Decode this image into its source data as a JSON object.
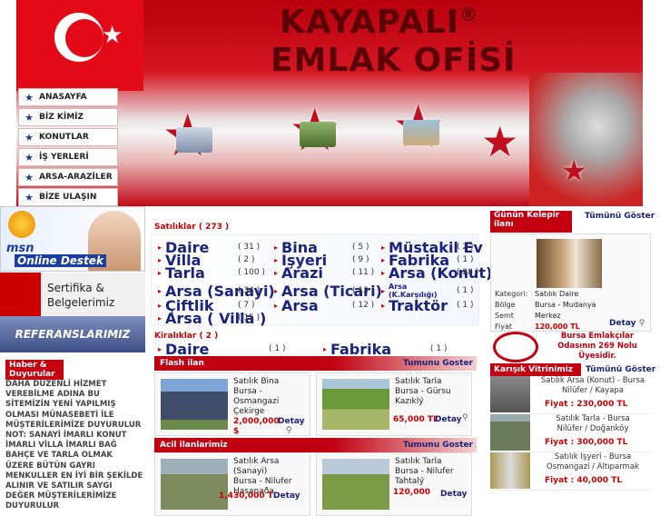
{
  "header": {
    "brand_line1": "KAYAPALI",
    "brand_mark": "®",
    "brand_line2": "EMLAK OFİSİ",
    "flag_star": "★"
  },
  "menu": [
    {
      "label": "ANASAYFA"
    },
    {
      "label": "BİZ KİMİZ"
    },
    {
      "label": "KONUTLAR"
    },
    {
      "label": "İŞ YERLERİ"
    },
    {
      "label": "ARSA-ARAZİLER"
    },
    {
      "label": "BİZE ULAŞIN"
    }
  ],
  "left": {
    "msn_line1": "msn",
    "msn_line2": "Online Destek",
    "sertifika1": "Sertifika &",
    "sertifika2": "Belgelerimiz",
    "referans": "REFERANSLARIMIZ",
    "haber_title": "Haber & Duyurular",
    "haber_text": "DAHA DÜZENLİ HİZMET VEREBİLME ADINA BU SİTEMİZİN YENİ YAPILMIŞ OLMASI MÜNASEBETİ İLE MÜŞTERİLERİMİZE DUYURULUR NOT: SANAYİ İMARLI KONUT İMARLI VİLLA İMARLI BAĞ BAHÇE VE TARLA OLMAK ÜZERE BÜTÜN GAYRI MENKULLER EN İYİ BİR ŞEKİLDE ALINIR VE SATILIR SAYGI DEĞER MÜŞTERİLERİMİZE DUYURULUR"
  },
  "satiliklar": {
    "title": "Satılıklar ( 273 )",
    "items": [
      {
        "label": "Daire",
        "count": "( 31 )"
      },
      {
        "label": "Bina",
        "count": "( 5 )"
      },
      {
        "label": "Müstakil Ev",
        "count": "( 2 )"
      },
      {
        "label": "Villa",
        "count": "( 2 )"
      },
      {
        "label": "Işyeri",
        "count": "( 9 )"
      },
      {
        "label": "Fabrika",
        "count": "( 1 )"
      },
      {
        "label": "Tarla",
        "count": "( 100 )"
      },
      {
        "label": "Arazi",
        "count": "( 11 )"
      },
      {
        "label": "Arsa (Konut)",
        "count": "( 28 )"
      },
      {
        "label": "Arsa (Sanayi)",
        "count": "( 34 )"
      },
      {
        "label": "Arsa (Ticari)",
        "count": "( 12 )"
      },
      {
        "label": "Arsa (K.Karşılığı)",
        "count": "( 1 )"
      },
      {
        "label": "Çiftlik",
        "count": "( 7 )"
      },
      {
        "label": "Arsa",
        "count": "( 12 )"
      },
      {
        "label": "Traktör",
        "count": "( 1 )"
      },
      {
        "label": "Arsa ( Villa )",
        "count": "( 15 )"
      }
    ]
  },
  "kiraliklar": {
    "title": "Kiralıklar ( 2 )",
    "items": [
      {
        "label": "Daire",
        "count": "( 1 )"
      },
      {
        "label": "Fabrika",
        "count": "( 1 )"
      }
    ]
  },
  "flash": {
    "title": "Flash ilan",
    "more": "Tumunu Goster",
    "cards": [
      {
        "l1": "Satılık Bina",
        "l2": "Bursa -",
        "l3": "Osmangazi",
        "l4": "Çekirge",
        "price": "2,000,000",
        "price2": "$",
        "detay": "Detay"
      },
      {
        "l1": "Satılık Tarla",
        "l2": "Bursa - Gürsu",
        "l3": "Kazıklý",
        "l4": "",
        "price": "65,000 TL",
        "price2": "",
        "detay": "Detay"
      }
    ]
  },
  "acil": {
    "title": "Acil ilanlarimiz",
    "more": "Tumunu Goster",
    "cards": [
      {
        "l1": "Satılık Arsa (Sanayi)",
        "l2": "Bursa - Nilufer",
        "l3": "Hasanaða",
        "price": "1,430,000 TL",
        "detay": "Detay"
      },
      {
        "l1": "Satılık Tarla",
        "l2": "Bursa - Nilufer",
        "l3": "Tahtalý",
        "price": "120,000",
        "detay": "Detay"
      }
    ]
  },
  "kelepir": {
    "title1": "Günün Kelepir",
    "title2": "ilanı",
    "more": "Tümünü Göster",
    "kategori_k": "Kategori:",
    "kategori_v": "Satılık Daire",
    "bolge_k": "Bölge",
    "bolge_v": "Bursa - Mudanya",
    "semt_k": "Semt",
    "semt_v": "Merkez",
    "fiyat_k": "Fiyat",
    "fiyat_v": "120,000 TL",
    "detay": "Detay"
  },
  "bursa_emlak": {
    "l1": "Bursa Emlakçılar",
    "l2": "Odasının 269 Nolu",
    "l3": "Üyesidir."
  },
  "karisik": {
    "title": "Karışık Vitrinimiz",
    "more": "Tümünü Göster",
    "items": [
      {
        "l1": "Satılık Arsa (Konut) - Bursa",
        "l2": "Nilüfer / Kayapa",
        "price": "Fiyat : 230,000 TL"
      },
      {
        "l1": "Satılık Tarla - Bursa",
        "l2": "Nilüfer / Doğanköy",
        "price": "Fiyat : 300,000 TL"
      },
      {
        "l1": "Satılık Işyeri - Bursa",
        "l2": "Osmangazi / Altıparmak",
        "price": "Fiyat : 40,000 TL"
      }
    ]
  },
  "colors": {
    "brand_red": "#c40010",
    "link_blue": "#1a237e"
  }
}
